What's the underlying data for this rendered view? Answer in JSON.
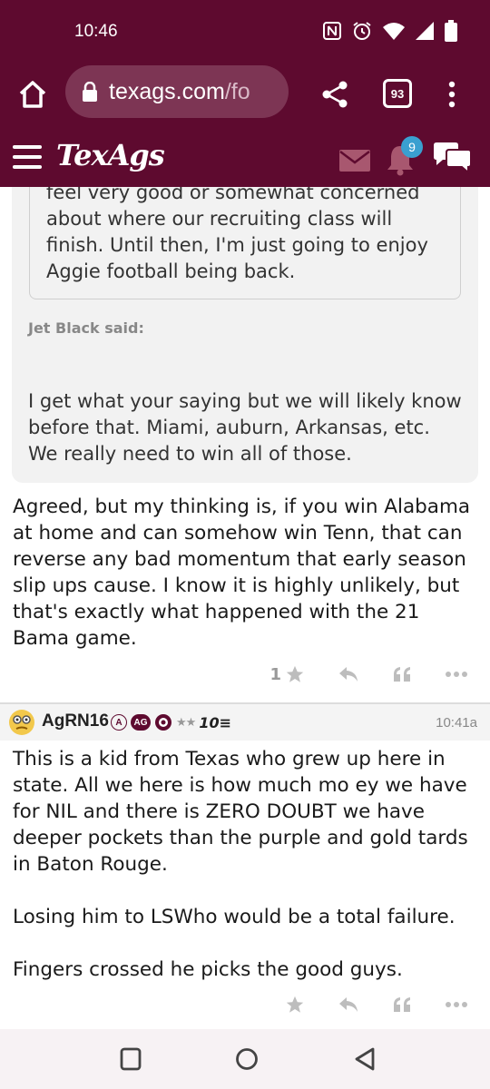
{
  "status_bar": {
    "time": "10:46"
  },
  "browser": {
    "url_main": "texags.com",
    "url_dim": "/fo",
    "tab_count": "93"
  },
  "site": {
    "logo": "TexAgs",
    "notification_count": "9"
  },
  "quote": {
    "inner_text": "feel very good or somewhat concerned about where our recruiting class will finish. Until then, I'm just going to enjoy Aggie football being back.",
    "attribution": "Jet Black said:",
    "outer_text": "I get what your saying but we will likely know before that. Miami, auburn, Arkansas, etc. We really need to win all of those."
  },
  "post1": {
    "body": "Agreed, but my thinking is, if you win Alabama at home and can somehow win Tenn, that can reverse any bad momentum that early season slip ups cause. I know it is highly unlikely, but that's exactly what happened with the 21 Bama game.",
    "star_count": "1"
  },
  "post2": {
    "username": "AgRN16",
    "badge_a": "A",
    "badge_ag": "AG",
    "stars": "★★",
    "rank": "10≡",
    "timestamp": "10:41a",
    "para1": "This is a kid from Texas who grew up here in state. All we here is how much mo ey we have for NIL and there is ZERO DOUBT we have deeper pockets than the purple and gold tards in Baton Rouge.",
    "para2": "Losing him to LSWho would be a total failure.",
    "para3": "Fingers crossed he picks the good guys."
  },
  "colors": {
    "maroon": "#5e0a2f",
    "badge_blue": "#3aa0d0"
  }
}
